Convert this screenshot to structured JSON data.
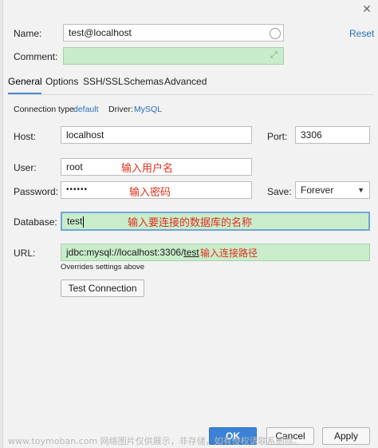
{
  "window": {
    "close_symbol": "✕"
  },
  "general": {
    "name_label": "Name:",
    "name_value": "test@localhost",
    "reset_label": "Reset",
    "comment_label": "Comment:",
    "comment_value": ""
  },
  "tabs": [
    {
      "label": "General",
      "active": true
    },
    {
      "label": "Options",
      "active": false
    },
    {
      "label": "SSH/SSL",
      "active": false
    },
    {
      "label": "Schemas",
      "active": false
    },
    {
      "label": "Advanced",
      "active": false
    }
  ],
  "connection": {
    "type_label": "Connection type:",
    "type_value": "default",
    "driver_label": "Driver:",
    "driver_value": "MySQL"
  },
  "fields": {
    "host_label": "Host:",
    "host_value": "localhost",
    "port_label": "Port:",
    "port_value": "3306",
    "user_label": "User:",
    "user_value": "root",
    "password_label": "Password:",
    "password_value": "••••••",
    "save_label": "Save:",
    "save_value": "Forever",
    "database_label": "Database:",
    "database_value": "test",
    "url_label": "URL:",
    "url_prefix": "jdbc:mysql://localhost:3306/",
    "url_db": "test",
    "url_note": "Overrides settings above"
  },
  "annotations": {
    "user": "输入用户名",
    "password": "输入密码",
    "database": "输入要连接的数据库的名称",
    "url": "输入连接路径"
  },
  "buttons": {
    "test_connection": "Test Connection",
    "ok": "OK",
    "cancel": "Cancel",
    "apply": "Apply"
  },
  "watermark": "www.toymoban.com 网络图片仅供展示，非存储，如有侵权请联系删除。",
  "colors": {
    "accent": "#3b82d6",
    "link": "#2a6db8",
    "field_green": "#c9eccb",
    "annotation_red": "#e0301e"
  }
}
